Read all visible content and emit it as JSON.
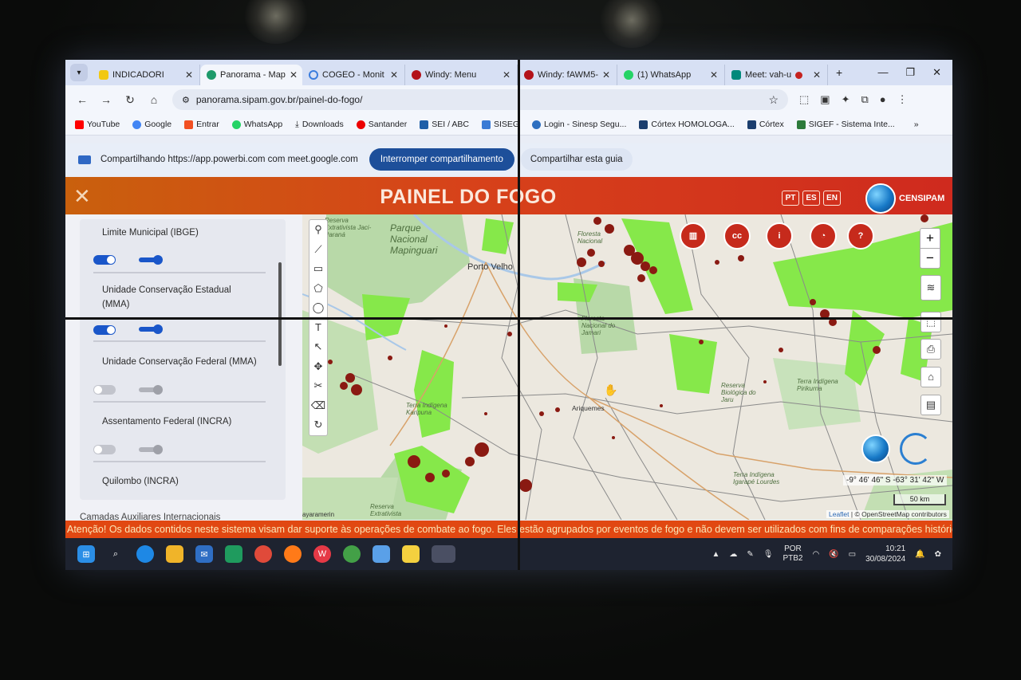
{
  "browser": {
    "tabs": [
      {
        "label": "INDICADORI",
        "icon": "powerbi-icon",
        "color": "#f2c811"
      },
      {
        "label": "Panorama - Map",
        "icon": "globe-icon",
        "color": "#1e9a6b"
      },
      {
        "label": "COGEO - Monit",
        "icon": "loading-icon",
        "color": "#3b7ddd"
      },
      {
        "label": "Windy: Menu",
        "icon": "windy-icon",
        "color": "#b3121a"
      },
      {
        "label": "Windy: fAWM5-",
        "icon": "windy-icon",
        "color": "#b3121a"
      },
      {
        "label": "(1) WhatsApp",
        "icon": "whatsapp-icon",
        "color": "#25d366"
      },
      {
        "label": "Meet: vah-u",
        "icon": "meet-icon",
        "color": "#00897b"
      }
    ],
    "active_tab_index": 1,
    "new_tab_glyph": "+",
    "window_controls": [
      "—",
      "❐",
      "✕"
    ],
    "url": "panorama.sipam.gov.br/painel-do-fogo/",
    "bookmarks": [
      {
        "label": "YouTube",
        "color": "#ff0000"
      },
      {
        "label": "Google",
        "color": "#4285f4"
      },
      {
        "label": "Entrar",
        "color": "#f25022"
      },
      {
        "label": "WhatsApp",
        "color": "#25d366"
      },
      {
        "label": "Downloads",
        "color": "#333333"
      },
      {
        "label": "Santander",
        "color": "#ec0000"
      },
      {
        "label": "SEI / ABC",
        "color": "#1f5fa8"
      },
      {
        "label": "SISEG",
        "color": "#3a7bd5"
      },
      {
        "label": "Login - Sinesp Segu...",
        "color": "#2d6fc0"
      },
      {
        "label": "Córtex HOMOLOGA...",
        "color": "#1b3e6e"
      },
      {
        "label": "Córtex",
        "color": "#1b3e6e"
      },
      {
        "label": "SIGEF - Sistema Inte...",
        "color": "#2c7a3a"
      }
    ],
    "bookmarks_more": "»"
  },
  "sharebar": {
    "message": "Compartilhando https://app.powerbi.com com meet.google.com",
    "stop_button": "Interromper compartilhamento",
    "share_tab_button": "Compartilhar esta guia"
  },
  "app": {
    "title": "PAINEL DO FOGO",
    "languages": [
      "PT",
      "ES",
      "EN"
    ],
    "logo_text": "CENSIPAM",
    "brand_colors": {
      "header_start": "#c9600d",
      "header_end": "#cf2a1e",
      "toggle_on": "#1a56c9"
    }
  },
  "sidebar": {
    "layers": [
      {
        "label": "Limite Municipal (IBGE)",
        "enabled": true
      },
      {
        "label": "Unidade Conservação Estadual (MMA)",
        "enabled": true
      },
      {
        "label": "Unidade Conservação Federal (MMA)",
        "enabled": false
      },
      {
        "label": "Assentamento Federal (INCRA)",
        "enabled": false
      },
      {
        "label": "Quilombo (INCRA)",
        "enabled": false
      }
    ],
    "section_bottom": "Camadas Auxiliares Internacionais"
  },
  "map": {
    "place_labels": [
      {
        "text": "Parque Nacional Mapinguari"
      },
      {
        "text": "Porto Velho"
      },
      {
        "text": "Floresta Nacional do Jamari"
      },
      {
        "text": "Ariquemes"
      },
      {
        "text": "Terra Indígena Karipuna"
      },
      {
        "text": "Reserva Biológica do Jaru"
      },
      {
        "text": "Terra Indígena Pirikurna"
      },
      {
        "text": "Terra Indígena Igarapé Lourdes"
      },
      {
        "text": "Reserva Extrativista"
      },
      {
        "text": "Floresta Nacional"
      },
      {
        "text": "Reserva Extrativista Jaci-Paraná"
      }
    ],
    "action_buttons": [
      "chart-icon",
      "cc-icon",
      "info-icon",
      "pie-icon",
      "help-icon"
    ],
    "coordinates": "-9° 46' 46\" S -63° 31' 42\" W",
    "scale": "50 km",
    "attribution_leaflet": "Leaflet",
    "attribution_osm": "| © OpenStreetMap contributors",
    "corner_label": "ayaramerin"
  },
  "warning": "Atenção! Os dados contidos neste sistema visam dar suporte às operações de combate ao fogo. Eles estão agrupados por eventos de fogo e não devem ser utilizados com fins de comparações históricas com",
  "taskbar": {
    "language": "POR",
    "layout": "PTB2",
    "time": "10:21",
    "date": "30/08/2024"
  }
}
